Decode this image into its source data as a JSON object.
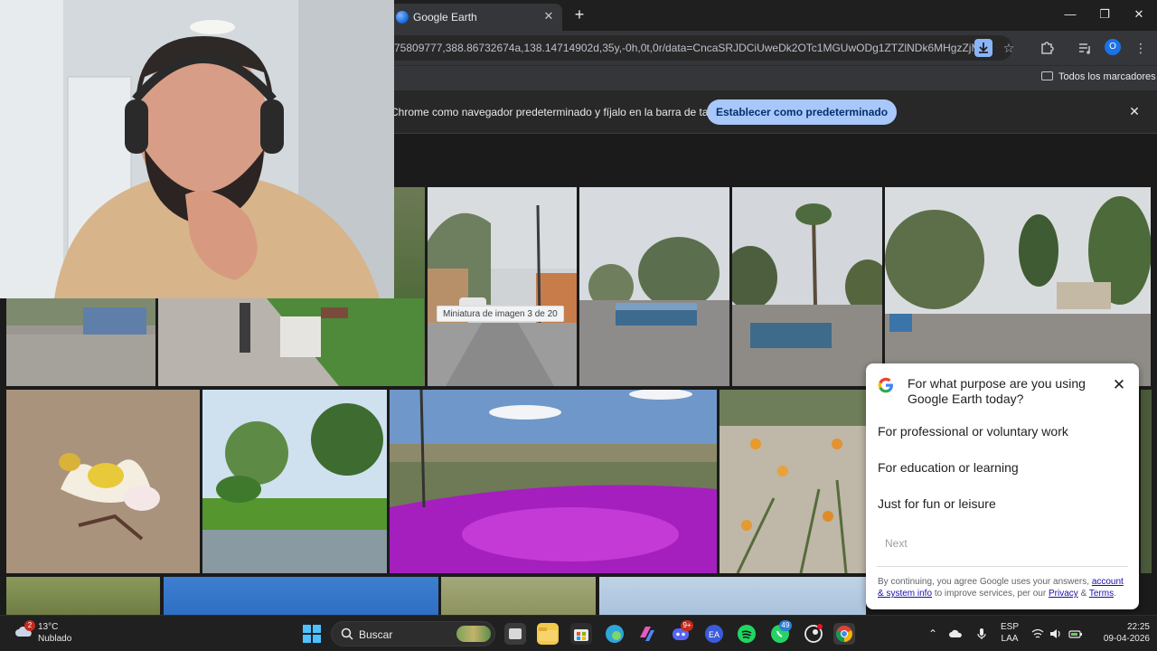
{
  "browser": {
    "tab_title": "Google Earth",
    "tab_close": "✕",
    "new_tab": "+",
    "window_minimize": "—",
    "window_maximize": "❐",
    "window_close": "✕",
    "url": "75809777,388.86732674a,138.14714902d,35y,-0h,0t,0r/data=CncaSRJDCiUweDk2OTc1MGUwODg1ZTZlNDk6MHgzZjMxO...",
    "bookmarks_folder": "Todos los marcadores",
    "infobar_text": "Chrome como navegador predeterminado y fíjalo en la barra de tareas",
    "infobar_button": "Establecer como predeterminado",
    "infobar_close": "✕",
    "profile_initial": "O"
  },
  "gallery": {
    "tooltip": "Miniatura de imagen 3 de 20"
  },
  "dialog": {
    "title": "For what purpose are you using Google Earth today?",
    "close": "✕",
    "options": [
      "For professional or voluntary work",
      "For education or learning",
      "Just for fun or leisure"
    ],
    "next": "Next",
    "footer_prefix": "By continuing, you agree Google uses your answers,",
    "footer_link1": "account & system info",
    "footer_middle": "to improve services, per our",
    "footer_link2": "Privacy",
    "footer_amp": "&",
    "footer_link3": "Terms",
    "footer_end": "."
  },
  "taskbar": {
    "weather_badge": "2",
    "temperature": "13°C",
    "weather_desc": "Nublado",
    "search_placeholder": "Buscar",
    "discord_badge": "9+",
    "whatsapp_badge": "49",
    "lang_top": "ESP",
    "lang_bottom": "LAA",
    "time": "22:25",
    "date": "09-04-2026"
  },
  "icons": [
    "google-earth-favicon",
    "download-icon",
    "star-icon",
    "extensions-icon",
    "media-icon",
    "menu-icon",
    "folder-icon",
    "google-logo",
    "windows-start-icon",
    "search-icon",
    "cloud-weather-icon",
    "wifi-icon",
    "volume-icon",
    "battery-icon",
    "mic-icon",
    "onedrive-icon",
    "chevron-up-icon"
  ],
  "colors": {
    "accent": "#a8c7fa",
    "dialog_bg": "#ffffff",
    "link": "#1a0dab",
    "taskbar": "#202020"
  }
}
